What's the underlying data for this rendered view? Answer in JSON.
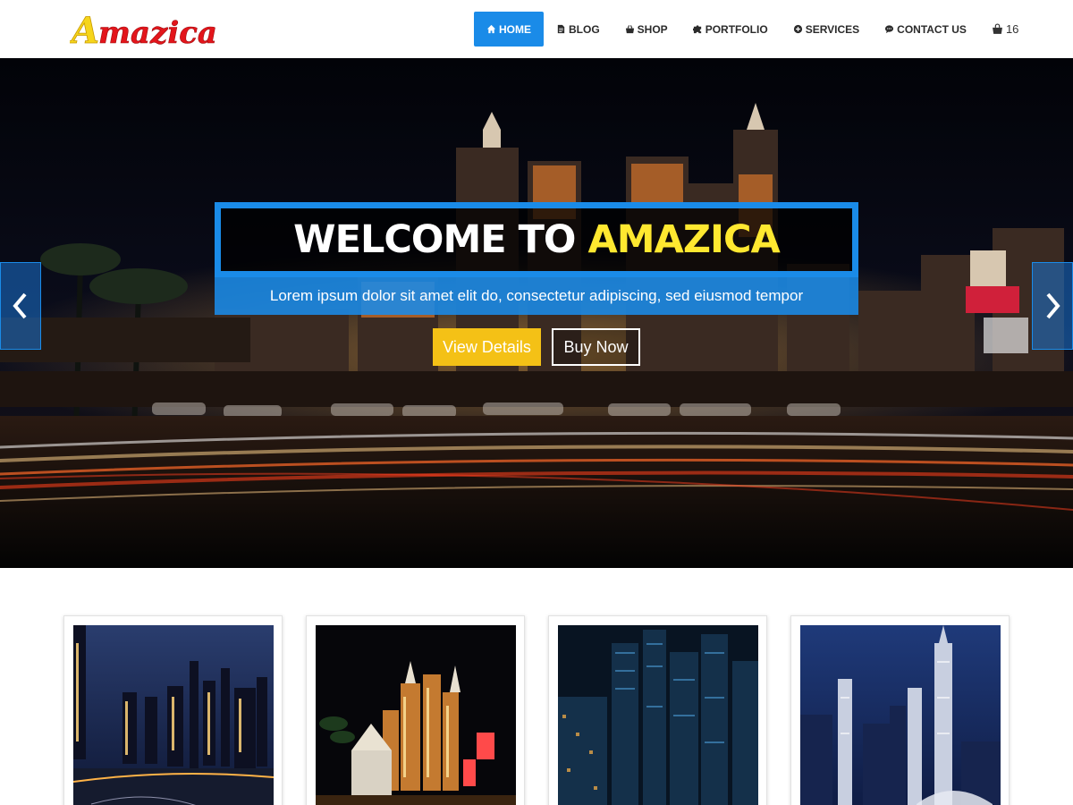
{
  "site": {
    "logo_text": "Amazica"
  },
  "nav": {
    "items": [
      {
        "label": "HOME",
        "icon": "home-icon",
        "active": true
      },
      {
        "label": "BLOG",
        "icon": "document-icon",
        "active": false
      },
      {
        "label": "SHOP",
        "icon": "shop-bag-icon",
        "active": false
      },
      {
        "label": "PORTFOLIO",
        "icon": "puzzle-icon",
        "active": false
      },
      {
        "label": "SERVICES",
        "icon": "plus-circle-icon",
        "active": false
      },
      {
        "label": "CONTACT US",
        "icon": "chat-bubble-icon",
        "active": false
      }
    ],
    "cart": {
      "icon": "cart-bag-icon",
      "count": "16"
    }
  },
  "hero": {
    "title_prefix": "WELCOME TO ",
    "title_highlight": "AMAZICA",
    "subtitle": "Lorem ipsum dolor sit amet elit do, consectetur adipiscing, sed eiusmod tempor",
    "primary_button": "View Details",
    "secondary_button": "Buy Now",
    "prev_icon": "chevron-left-icon",
    "next_icon": "chevron-right-icon"
  },
  "gallery": {
    "items": [
      {
        "image": "city-skyline-river-night"
      },
      {
        "image": "las-vegas-casino-night"
      },
      {
        "image": "downtown-skyscrapers-night"
      },
      {
        "image": "dubai-towers-dusk"
      }
    ]
  },
  "colors": {
    "accent": "#1a8be8",
    "highlight": "#ffe830",
    "button_yellow": "#f4c116",
    "logo_red": "#e3151b",
    "logo_yellow": "#f6d51b"
  }
}
